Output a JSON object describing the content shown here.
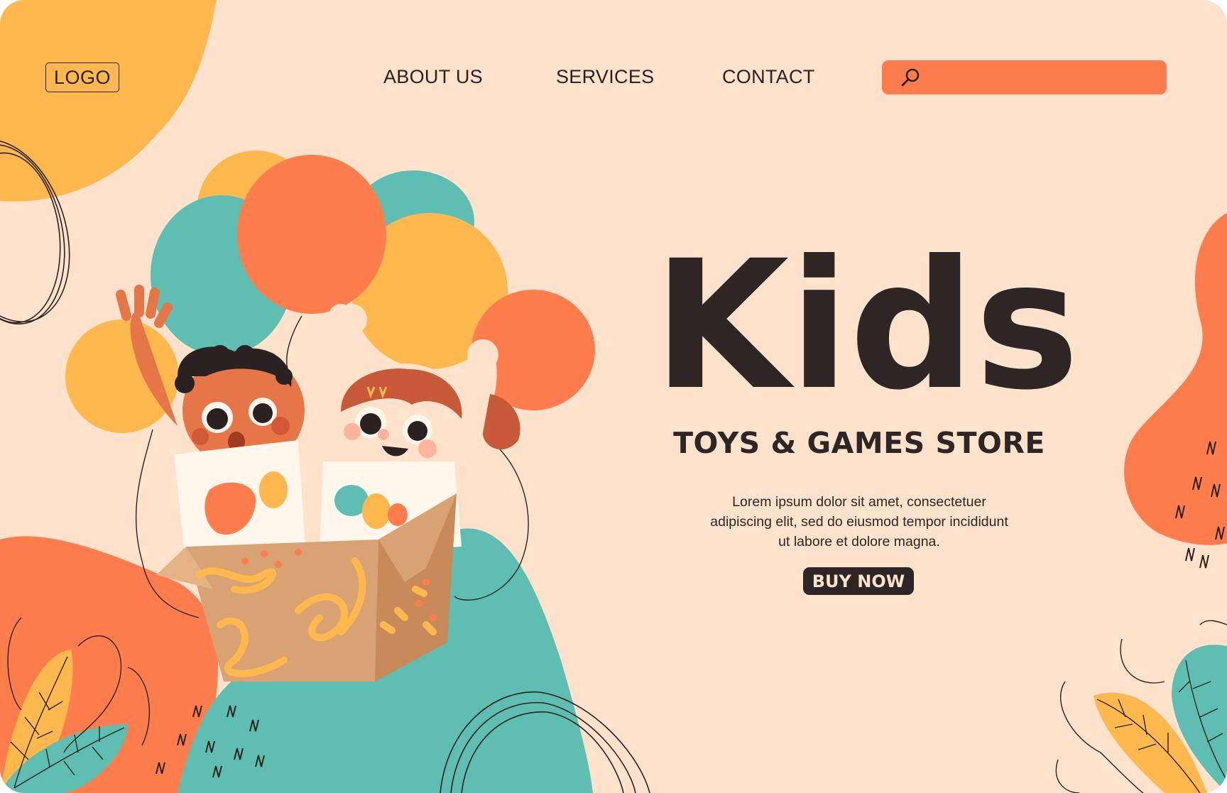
{
  "header": {
    "logo": "LOGO",
    "nav": [
      "ABOUT US",
      "SERVICES",
      "CONTACT"
    ],
    "search": {
      "placeholder": "",
      "value": ""
    }
  },
  "hero": {
    "title": "Kids",
    "subtitle": "TOYS & GAMES STORE",
    "description": "Lorem ipsum dolor sit amet, consectetuer adipiscing elit, sed do eiusmod tempor incididunt ut labore et dolore magna.",
    "button": "BUY NOW"
  },
  "colors": {
    "background": "#fee2cc",
    "accent_orange": "#ff7d4d",
    "accent_yellow": "#ffb84d",
    "accent_teal": "#5fbeb2",
    "dark_text": "#2d2624"
  },
  "icons": [
    "search-icon"
  ]
}
